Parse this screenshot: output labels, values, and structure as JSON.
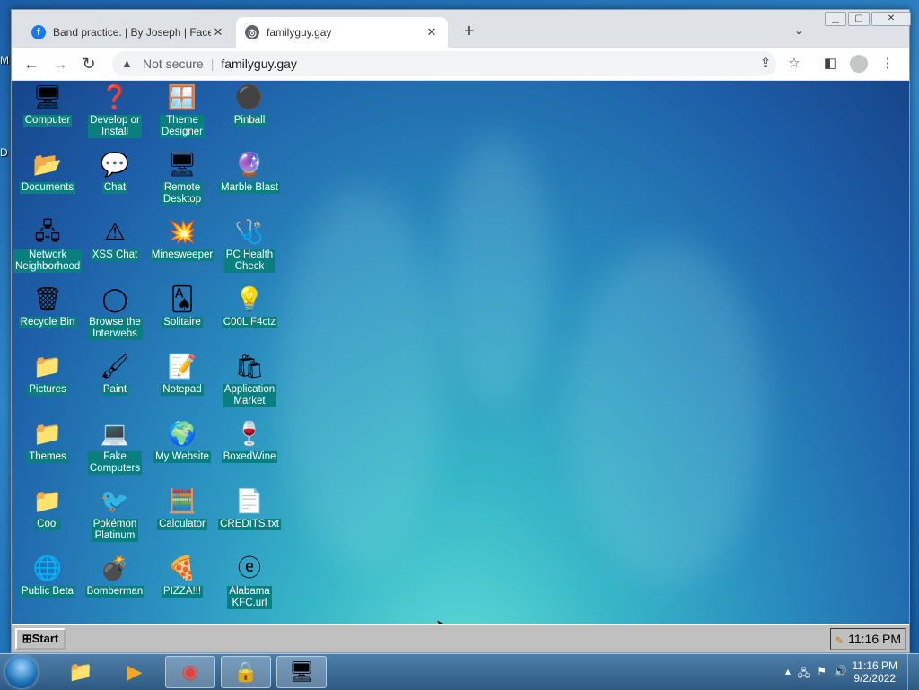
{
  "host_desktop": {
    "letters": [
      "M",
      "D"
    ]
  },
  "browser": {
    "tabs": [
      {
        "title": "Band practice. | By Joseph | Faceb",
        "favicon": "facebook-icon",
        "active": false
      },
      {
        "title": "familyguy.gay",
        "favicon": "globe-icon",
        "active": true
      }
    ],
    "newtab_glyph": "+",
    "tab_close_glyph": "✕",
    "security_label": "Not secure",
    "url": "familyguy.gay"
  },
  "emulated_desktop": {
    "columns": [
      [
        {
          "label": "Computer",
          "icon": "computer-icon",
          "glyph": "🖥"
        },
        {
          "label": "Documents",
          "icon": "documents-folder-icon",
          "glyph": "📂"
        },
        {
          "label": "Network\nNeighborhood",
          "icon": "network-icon",
          "glyph": "🖧"
        },
        {
          "label": "Recycle Bin",
          "icon": "recycle-bin-icon",
          "glyph": "🗑"
        },
        {
          "label": "Pictures",
          "icon": "folder-icon",
          "glyph": "📁"
        },
        {
          "label": "Themes",
          "icon": "folder-icon",
          "glyph": "📁"
        },
        {
          "label": "Cool",
          "icon": "folder-icon",
          "glyph": "📁"
        },
        {
          "label": "Public Beta",
          "icon": "globe-icon",
          "glyph": "🌐"
        }
      ],
      [
        {
          "label": "Develop or\nInstall",
          "icon": "help-icon",
          "glyph": "❓"
        },
        {
          "label": "Chat",
          "icon": "chat-bubble-icon",
          "glyph": "💬"
        },
        {
          "label": "XSS Chat",
          "icon": "chat-warning-icon",
          "glyph": "⚠"
        },
        {
          "label": "Browse the\nInterwebs",
          "icon": "browser-icon",
          "glyph": "◯"
        },
        {
          "label": "Paint",
          "icon": "paint-icon",
          "glyph": "🖌"
        },
        {
          "label": "Fake\nComputers",
          "icon": "computer-icon",
          "glyph": "💻"
        },
        {
          "label": "Pokémon\nPlatinum",
          "icon": "pokemon-icon",
          "glyph": "🐦"
        },
        {
          "label": "Bomberman",
          "icon": "bomberman-icon",
          "glyph": "💣"
        }
      ],
      [
        {
          "label": "Theme\nDesigner",
          "icon": "theme-designer-icon",
          "glyph": "🪟"
        },
        {
          "label": "Remote\nDesktop",
          "icon": "remote-desktop-icon",
          "glyph": "🖥"
        },
        {
          "label": "Minesweeper",
          "icon": "mine-icon",
          "glyph": "💥"
        },
        {
          "label": "Solitaire",
          "icon": "cards-icon",
          "glyph": "🂡"
        },
        {
          "label": "Notepad",
          "icon": "notepad-icon",
          "glyph": "📝"
        },
        {
          "label": "My Website",
          "icon": "globe-icon",
          "glyph": "🌍"
        },
        {
          "label": "Calculator",
          "icon": "calculator-icon",
          "glyph": "🧮"
        },
        {
          "label": "PIZZA!!!",
          "icon": "pizza-icon",
          "glyph": "🍕"
        }
      ],
      [
        {
          "label": "Pinball",
          "icon": "pinball-icon",
          "glyph": "⚫"
        },
        {
          "label": "Marble Blast",
          "icon": "marble-icon",
          "glyph": "🔮"
        },
        {
          "label": "PC Health\nCheck",
          "icon": "health-check-icon",
          "glyph": "🩺"
        },
        {
          "label": "C00L F4ctz",
          "icon": "lightbulb-icon",
          "glyph": "💡"
        },
        {
          "label": "Application\nMarket",
          "icon": "market-bag-icon",
          "glyph": "🛍"
        },
        {
          "label": "BoxedWine",
          "icon": "wine-icon",
          "glyph": "🍷"
        },
        {
          "label": "CREDITS.txt",
          "icon": "text-file-icon",
          "glyph": "📄"
        },
        {
          "label": "Alabama\nKFC.url",
          "icon": "ie-shortcut-icon",
          "glyph": "ⓔ"
        }
      ]
    ],
    "start_label": "Start",
    "clock": "11:16 PM"
  },
  "windows_taskbar": {
    "items": [
      {
        "name": "explorer-icon",
        "glyph": "📁"
      },
      {
        "name": "media-player-icon",
        "glyph": "▶"
      },
      {
        "name": "chrome-icon",
        "glyph": "◉"
      },
      {
        "name": "security-app-icon",
        "glyph": "🔒"
      },
      {
        "name": "terminal-app-icon",
        "glyph": "🖥"
      }
    ],
    "time": "11:16 PM",
    "date": "9/2/2022"
  }
}
